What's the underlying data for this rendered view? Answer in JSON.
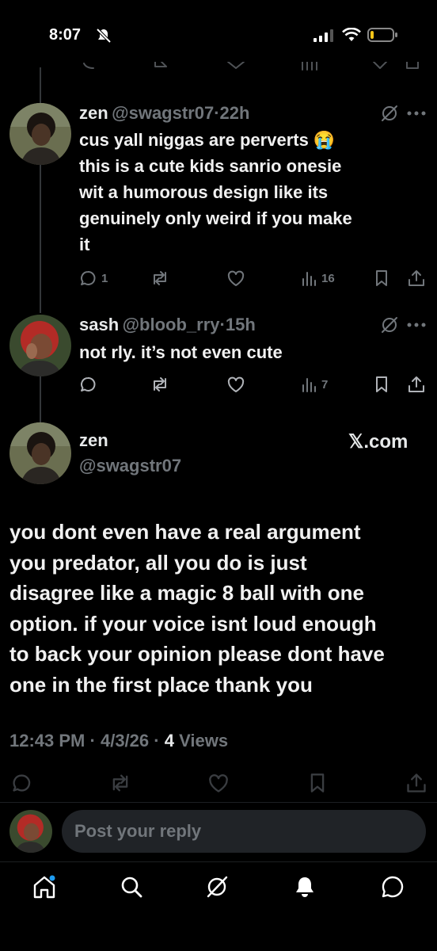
{
  "status_bar": {
    "time": "8:07"
  },
  "thread": [
    {
      "name": "zen",
      "handle": "@swagstr07",
      "separator": "·",
      "time": "22h",
      "text_lines": [
        "cus yall niggas are perverts 😭",
        "this is a cute kids sanrio onesie",
        "wit a humorous design like its",
        "genuinely only weird if you make",
        "it"
      ],
      "replies": "1",
      "views": "16"
    },
    {
      "name": "sash",
      "handle": "@bloob_rry",
      "separator": "·",
      "time": "15h",
      "text_lines": [
        "not rly. it’s not even cute"
      ],
      "views": "7"
    }
  ],
  "main_post": {
    "name": "zen",
    "handle": "@swagstr07",
    "watermark": "𝕏.com",
    "text_lines": [
      "you dont even have a real argument",
      "you predator, all you do is just",
      "disagree like a magic 8 ball with one",
      "option. if your voice isnt loud enough",
      "to back your opinion please dont have",
      "one in the first place thank you"
    ],
    "time": "12:43 PM",
    "date": "4/3/26",
    "separator": "·",
    "views_count": "4",
    "views_label": "Views"
  },
  "reply": {
    "placeholder": "Post your reply"
  },
  "bottom_nav": [
    "home-icon",
    "search-icon",
    "grok-icon",
    "notifications-icon",
    "messages-icon"
  ],
  "colors": {
    "background": "#000000",
    "muted": "#71767b",
    "accent": "#1d9bf0"
  }
}
